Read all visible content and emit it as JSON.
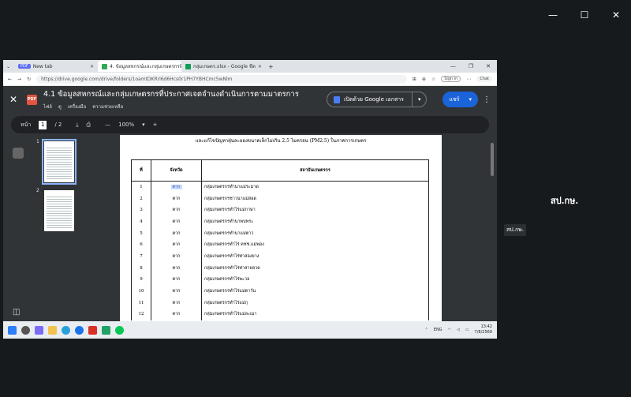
{
  "browser": {
    "tabs": [
      {
        "label": "New tab",
        "chip": "PDF"
      },
      {
        "label": "4. ข้อมูลสหกรณ์และกลุ่มเกษตรกรที่ประกาศ",
        "active": true
      },
      {
        "label": "กลุ่มเกษตร.xlsx - Google ชีต"
      }
    ],
    "url": "https://drive.google.com/drive/folders/1oamtDKRrl6d6Hcs0r1PH7YBHCmc5wNlm",
    "sign_in": "Sign in",
    "chat": "Chat"
  },
  "viewer": {
    "badge": "PDF",
    "title": "4.1 ข้อมูลสหกรณ์และกลุ่มเกษตรกรที่ประกาศเจตจำนงดำเนินการตามมาตรการ",
    "menu": [
      "ไฟล์",
      "ดู",
      "เครื่องมือ",
      "ความช่วยเหลือ"
    ],
    "open_with": "เปิดด้วย Google เอกสาร",
    "share": "แชร์",
    "page_label": "หน้า",
    "page_current": "1",
    "page_total": "/ 2",
    "zoom": "100%",
    "thumb_numbers": [
      "1",
      "2"
    ]
  },
  "document": {
    "heading": "และแก้ไขปัญหาฝุ่นละอองขนาดเล็กไม่เกิน 2.5 ไมครอน (PM2.5) ในภาคการเกษตร",
    "columns": [
      "ที่",
      "จังหวัด",
      "สถาบันเกษตรกร"
    ],
    "rows": [
      {
        "no": "1",
        "province": "ตาก",
        "org": "กลุ่มเกษตรกรทำนาแม่ระมาด"
      },
      {
        "no": "2",
        "province": "ตาก",
        "org": "กลุ่มเกษตรกรชาวนาแม่สอด"
      },
      {
        "no": "3",
        "province": "ตาก",
        "org": "กลุ่มเกษตรกรทำไร่แม่กาษา"
      },
      {
        "no": "4",
        "province": "ตาก",
        "org": "กลุ่มเกษตรกรทำนาพบพระ"
      },
      {
        "no": "5",
        "province": "ตาก",
        "org": "กลุ่มเกษตรกรทำนาแม่ตาว"
      },
      {
        "no": "6",
        "province": "ตาก",
        "org": "กลุ่มเกษตรกรทำไร่ คชช.แม่พ่อง"
      },
      {
        "no": "7",
        "province": "ตาก",
        "org": "กลุ่มเกษตรกรทำไร่ท่าสองยาง"
      },
      {
        "no": "8",
        "province": "ตาก",
        "org": "กลุ่มเกษตรกรทำไร่ท่าสายลวด"
      },
      {
        "no": "9",
        "province": "ตาก",
        "org": "กลุ่มเกษตรกรทำไร่พะวอ"
      },
      {
        "no": "10",
        "province": "ตาก",
        "org": "กลุ่มเกษตรกรทำไร่แม่ตาวัน"
      },
      {
        "no": "11",
        "province": "ตาก",
        "org": "กลุ่มเกษตรกรทำไร่แม่กุ"
      },
      {
        "no": "12",
        "province": "ตาก",
        "org": "กลุ่มเกษตรกรทำไร่แม่ละเมา"
      }
    ]
  },
  "outer": {
    "title": "สป.กษ.",
    "badge": "สป.กษ."
  },
  "taskbar": {
    "lang": "ENG",
    "time": "13:42",
    "date": "7/8/2569"
  }
}
